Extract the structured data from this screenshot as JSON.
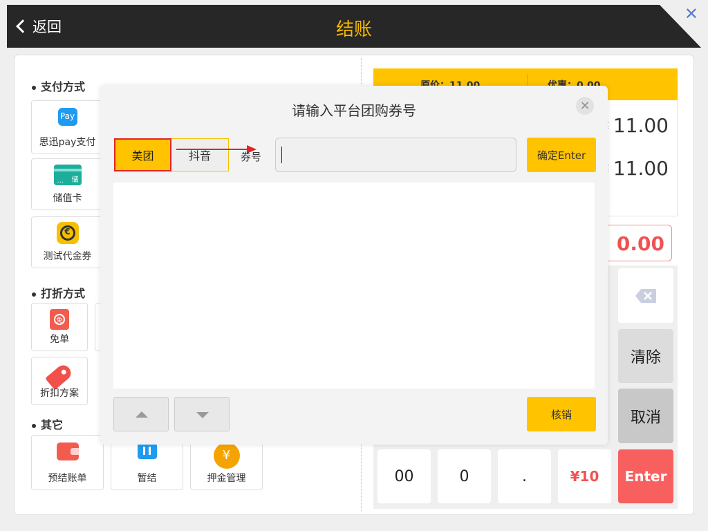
{
  "header": {
    "back_label": "返回",
    "title": "结账",
    "close_glyph": "✕"
  },
  "sections": {
    "payment": "支付方式",
    "discount": "打折方式",
    "other": "其它"
  },
  "payment_methods": [
    {
      "label": "思迅pay支付",
      "icon_text": "Pay",
      "icon": "pay-icon"
    },
    {
      "label": "储值卡",
      "icon_text": "储",
      "icon": "stored-value-card-icon"
    },
    {
      "label": "测试代金券",
      "icon_text": "€",
      "icon": "voucher-icon"
    }
  ],
  "discount_methods": [
    {
      "label": "免单",
      "icon_text": "免",
      "icon": "free-order-icon"
    },
    {
      "label": "折扣方案",
      "icon": "discount-tag-icon"
    }
  ],
  "other_methods": [
    {
      "label": "预结账单",
      "icon": "wallet-icon"
    },
    {
      "label": "暂结",
      "icon": "pause-icon"
    },
    {
      "label": "押金管理",
      "icon_text": "¥",
      "icon": "deposit-icon"
    }
  ],
  "summary": {
    "original_label": "原价：",
    "original_value": "11.00",
    "discount_label": "优惠：",
    "discount_value": "0.00",
    "yen": "¥",
    "amount_due": "11.00",
    "amount_received": "11.00",
    "pay_input_value": "0.00"
  },
  "keypad": {
    "clear": "清除",
    "cancel": "取消",
    "k00": "00",
    "k0": "0",
    "dot": ".",
    "yen10": "¥10",
    "enter": "Enter"
  },
  "dialog": {
    "title": "请输入平台团购券号",
    "close_glyph": "×",
    "tabs": [
      "美团",
      "抖音"
    ],
    "coupon_label": "券号",
    "coupon_value": "",
    "confirm_label": "确定Enter",
    "redeem_label": "核销"
  },
  "colors": {
    "accent": "#ffc300",
    "header_bg": "#272727",
    "title": "#f6b800",
    "danger": "#f05252",
    "highlight_border": "#e02424"
  }
}
